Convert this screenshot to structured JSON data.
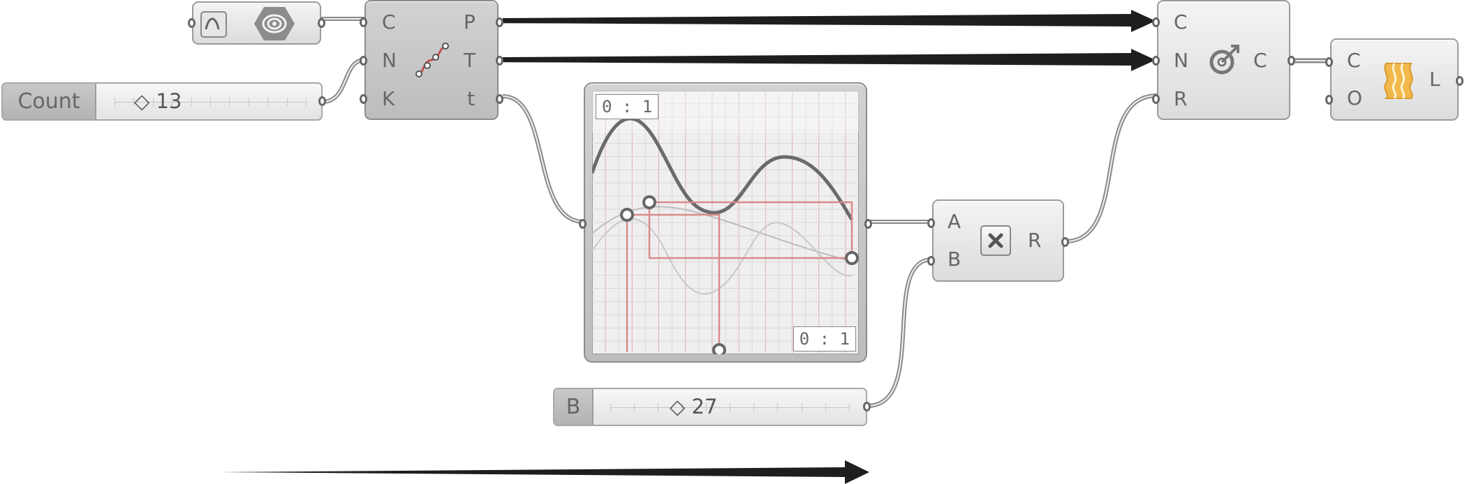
{
  "divide_curve": {
    "inputs": [
      "C",
      "N",
      "K"
    ],
    "outputs": [
      "P",
      "T",
      "t"
    ]
  },
  "count_slider": {
    "name": "Count",
    "value": "◇ 13"
  },
  "b_slider": {
    "name": "B",
    "value": "◇ 27"
  },
  "graph_mapper": {
    "x_domain": "0 : 1",
    "y_domain": "0 : 1"
  },
  "multiplication": {
    "inputs": [
      "A",
      "B"
    ],
    "outputs": [
      "R"
    ]
  },
  "circle_cnr": {
    "inputs": [
      "C",
      "N",
      "R"
    ],
    "outputs": [
      "C"
    ]
  },
  "loft": {
    "inputs": [
      "C",
      "O"
    ],
    "outputs": [
      "L"
    ]
  },
  "colors": {
    "wire": "#8a8a8a",
    "arrow": "#1e1e1e",
    "graph_grid_red": "#e29a9a",
    "loft_icon": "#f2b84b"
  },
  "icons": {
    "curve_param": "bezier-icon",
    "geometry": "spiral-hex-icon",
    "divide": "divide-curve-icon",
    "multiply": "multiply-icon",
    "circle": "circle-cnr-icon",
    "loft": "loft-icon"
  }
}
